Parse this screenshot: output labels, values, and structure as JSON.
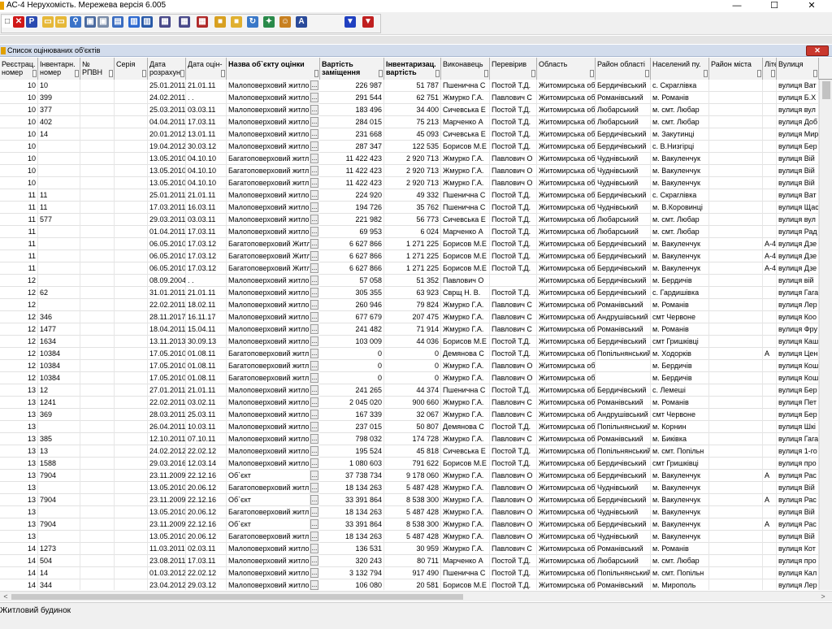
{
  "window": {
    "title": "АС-4 Нерухомість. Мережева версія 6.005",
    "minimize": "—",
    "maximize": "☐",
    "close": "✕"
  },
  "toolbar": {
    "buttons": [
      {
        "name": "new-icon",
        "glyph": "□",
        "color": "#ffffff"
      },
      {
        "name": "delete-icon",
        "glyph": "✕",
        "color": "#d01818"
      },
      {
        "name": "pdf-icon",
        "glyph": "P",
        "color": "#2a4ab0"
      },
      {
        "name": "open-folder-icon",
        "glyph": "▭",
        "color": "#e6b838"
      },
      {
        "name": "folder-icon",
        "glyph": "▭",
        "color": "#e6b838"
      },
      {
        "name": "search-icon",
        "glyph": "⚲",
        "color": "#3b73c8"
      },
      {
        "name": "copy-icon",
        "glyph": "▣",
        "color": "#4a6aa0"
      },
      {
        "name": "paste-icon",
        "glyph": "▣",
        "color": "#7a8ca8"
      },
      {
        "name": "clipboard-icon",
        "glyph": "▤",
        "color": "#3a6cc0"
      },
      {
        "name": "book-icon",
        "glyph": "▥",
        "color": "#2f6ad0"
      },
      {
        "name": "books-icon",
        "glyph": "▥",
        "color": "#2a5aa8"
      },
      {
        "name": "report-icon",
        "glyph": "▦",
        "color": "#4a4a8a"
      },
      {
        "name": "report-export-icon",
        "glyph": "▦",
        "color": "#4a4a8a"
      },
      {
        "name": "report-delete-icon",
        "glyph": "▦",
        "color": "#b02a2a"
      },
      {
        "name": "box-icon",
        "glyph": "■",
        "color": "#d8a020"
      },
      {
        "name": "package-icon",
        "glyph": "■",
        "color": "#e0b030"
      },
      {
        "name": "refresh-icon",
        "glyph": "↻",
        "color": "#3a78c8"
      },
      {
        "name": "map-icon",
        "glyph": "✦",
        "color": "#2a8a4a"
      },
      {
        "name": "users-icon",
        "glyph": "☺",
        "color": "#c88020"
      },
      {
        "name": "sort-icon",
        "glyph": "A",
        "color": "#2a4a9a"
      },
      {
        "name": "filter-icon",
        "glyph": "▼",
        "color": "#2040c0"
      },
      {
        "name": "filter-clear-icon",
        "glyph": "▼",
        "color": "#c02020"
      }
    ]
  },
  "panel": {
    "title": "Список оцінюваних об'єктів",
    "close": "✕"
  },
  "columns": [
    {
      "key": "c0",
      "label": "Реєстрац. номер",
      "bold": false
    },
    {
      "key": "c1",
      "label": "Інвентарн. номер",
      "bold": false
    },
    {
      "key": "c2",
      "label": "№ РПВН",
      "bold": false
    },
    {
      "key": "c3",
      "label": "Серія",
      "bold": false
    },
    {
      "key": "c4",
      "label": "Дата розрахун.",
      "bold": false
    },
    {
      "key": "c5",
      "label": "Дата оцін-",
      "bold": false
    },
    {
      "key": "c6",
      "label": "Назва об`єкту оцінки",
      "bold": true
    },
    {
      "key": "c7",
      "label": "Вартість заміщення",
      "bold": true
    },
    {
      "key": "c8",
      "label": "Інвентаризац. вартість",
      "bold": true
    },
    {
      "key": "c9",
      "label": "Виконавець",
      "bold": false
    },
    {
      "key": "c10",
      "label": "Перевірив",
      "bold": false
    },
    {
      "key": "c11",
      "label": "Область",
      "bold": false
    },
    {
      "key": "c12",
      "label": "Район області",
      "bold": false
    },
    {
      "key": "c13",
      "label": "Населений пу.",
      "bold": false
    },
    {
      "key": "c14",
      "label": "Район міста",
      "bold": false
    },
    {
      "key": "c15",
      "label": "Літе.",
      "bold": false
    },
    {
      "key": "c16",
      "label": "Вулиця",
      "bold": false
    }
  ],
  "rows": [
    [
      "10",
      "10",
      "",
      "",
      "25.01.2011",
      "21.01.11",
      "Малоповерховий житло",
      "226 987",
      "51 787",
      "Пшенична С",
      "Постой Т.Д.",
      "Житомирська об",
      "Бердичівський",
      "с. Скраглівка",
      "",
      "",
      "вулиця Ват"
    ],
    [
      "10",
      "399",
      "",
      "",
      "24.02.2011",
      ". .",
      "Малоповерховий житло",
      "291 544",
      "62 751",
      "Жмурко Г.А.",
      "Павлович С",
      "Житомирська об",
      "Романівський",
      "м. Романів",
      "",
      "",
      "вулиця Б.Х"
    ],
    [
      "10",
      "377",
      "",
      "",
      "25.03.2011",
      "03.03.11",
      "Малоповерховий житло",
      "183 496",
      "34 400",
      "Сичевська Е",
      "Постой Т.Д.",
      "Житомирська об",
      "Любарський",
      "м. смт. Любар",
      "",
      "",
      "вулиця вул"
    ],
    [
      "10",
      "402",
      "",
      "",
      "04.04.2011",
      "17.03.11",
      "Малоповерховий житло",
      "284 015",
      "75 213",
      "Марченко А",
      "Постой Т.Д.",
      "Житомирська об",
      "Любарський",
      "м. смт. Любар",
      "",
      "",
      "вулиця Доб"
    ],
    [
      "10",
      "14",
      "",
      "",
      "20.01.2012",
      "13.01.11",
      "Малоповерховий житло",
      "231 668",
      "45 093",
      "Сичевська Е",
      "Постой Т.Д.",
      "Житомирська об",
      "Бердичівський",
      "м. Закутинці",
      "",
      "",
      "вулиця Мир"
    ],
    [
      "10",
      "",
      "",
      "",
      "19.04.2012",
      "30.03.12",
      "Малоповерховий житло",
      "287 347",
      "122 535",
      "Борисов М.Е",
      "Постой Т.Д.",
      "Житомирська об",
      "Бердичівський",
      "с. В.Низгірці",
      "",
      "",
      "вулиця Бер"
    ],
    [
      "10",
      "",
      "",
      "",
      "13.05.2010",
      "04.10.10",
      "Багатоповерховий житл",
      "11 422 423",
      "2 920 713",
      "Жмурко Г.А.",
      "Павлович О",
      "Житомирська об",
      "Чуднівський",
      "м. Вакуленчук",
      "",
      "",
      "вулиця Вій"
    ],
    [
      "10",
      "",
      "",
      "",
      "13.05.2010",
      "04.10.10",
      "Багатоповерховий житл",
      "11 422 423",
      "2 920 713",
      "Жмурко Г.А.",
      "Павлович О",
      "Житомирська об",
      "Чуднівський",
      "м. Вакуленчук",
      "",
      "",
      "вулиця Вій"
    ],
    [
      "10",
      "",
      "",
      "",
      "13.05.2010",
      "04.10.10",
      "Багатоповерховий житл",
      "11 422 423",
      "2 920 713",
      "Жмурко Г.А.",
      "Павлович О",
      "Житомирська об",
      "Чуднівський",
      "м. Вакуленчук",
      "",
      "",
      "вулиця Вій"
    ],
    [
      "11",
      "11",
      "",
      "",
      "25.01.2011",
      "21.01.11",
      "Малоповерховий житло",
      "224 920",
      "49 332",
      "Пшенична С",
      "Постой Т.Д.",
      "Житомирська об",
      "Бердичівський",
      "с. Скраглівка",
      "",
      "",
      "вулиця Ват"
    ],
    [
      "11",
      "11",
      "",
      "",
      "17.03.2011",
      "16.03.11",
      "Малоповерховий житло",
      "194 726",
      "35 762",
      "Пшенична С",
      "Постой Т.Д.",
      "Житомирська об",
      "Чуднівський",
      "м. В.Коровинці",
      "",
      "",
      "вулиця Щас"
    ],
    [
      "11",
      "577",
      "",
      "",
      "29.03.2011",
      "03.03.11",
      "Малоповерховий житло",
      "221 982",
      "56 773",
      "Сичевська Е",
      "Постой Т.Д.",
      "Житомирська об",
      "Любарський",
      "м. смт. Любар",
      "",
      "",
      "вулиця вул"
    ],
    [
      "11",
      "",
      "",
      "",
      "01.04.2011",
      "17.03.11",
      "Малоповерховий житло",
      "69 953",
      "6 024",
      "Марченко А",
      "Постой Т.Д.",
      "Житомирська об",
      "Любарський",
      "м. смт. Любар",
      "",
      "",
      "вулиця Рад"
    ],
    [
      "11",
      "",
      "",
      "",
      "06.05.2010",
      "17.03.12",
      "Багатоповерховий Житл",
      "6 627 866",
      "1 271 225",
      "Борисов М.Е",
      "Постой Т.Д.",
      "Житомирська об",
      "Бердичівський",
      "м. Вакуленчук",
      "",
      "А-4",
      "вулиця Дзе"
    ],
    [
      "11",
      "",
      "",
      "",
      "06.05.2010",
      "17.03.12",
      "Багатоповерховий Житл",
      "6 627 866",
      "1 271 225",
      "Борисов М.Е",
      "Постой Т.Д.",
      "Житомирська об",
      "Бердичівський",
      "м. Вакуленчук",
      "",
      "А-4",
      "вулиця Дзе"
    ],
    [
      "11",
      "",
      "",
      "",
      "06.05.2010",
      "17.03.12",
      "Багатоповерховий Житл",
      "6 627 866",
      "1 271 225",
      "Борисов М.Е",
      "Постой Т.Д.",
      "Житомирська об",
      "Бердичівський",
      "м. Вакуленчук",
      "",
      "А-4",
      "вулиця Дзе"
    ],
    [
      "12",
      "",
      "",
      "",
      "08.09.2004",
      ". .",
      "Малоповерховий житло",
      "57 058",
      "51 352",
      "Павлович О",
      "",
      "Житомирська об",
      "Бердичівський",
      "м. Бердичів",
      "",
      "",
      "вулиця вій"
    ],
    [
      "12",
      "62",
      "",
      "",
      "31.01.2011",
      "21.01.11",
      "Малоповерховий житло",
      "305 355",
      "63 923",
      "Сврщ Н. В.",
      "Постой Т.Д.",
      "Житомирська об",
      "Бердичівський",
      "с. Гардишівка",
      "",
      "",
      "вулиця Гага"
    ],
    [
      "12",
      "",
      "",
      "",
      "22.02.2011",
      "18.02.11",
      "Малоповерховий житло",
      "260 946",
      "79 824",
      "Жмурко Г.А.",
      "Павлович С",
      "Житомирська об",
      "Романівський",
      "м. Романів",
      "",
      "",
      "вулиця Лер"
    ],
    [
      "12",
      "346",
      "",
      "",
      "28.11.2017",
      "16.11.17",
      "Малоповерховий житло",
      "677 679",
      "207 475",
      "Жмурко Г.А.",
      "Павлович С",
      "Житомирська об",
      "Андрушівський",
      "смт Червоне",
      "",
      "",
      "вулиця Коо"
    ],
    [
      "12",
      "1477",
      "",
      "",
      "18.04.2011",
      "15.04.11",
      "Малоповерховий житло",
      "241 482",
      "71 914",
      "Жмурко Г.А.",
      "Павлович С",
      "Житомирська об",
      "Романівський",
      "м. Романів",
      "",
      "",
      "вулиця Фру"
    ],
    [
      "12",
      "1634",
      "",
      "",
      "13.11.2013",
      "30.09.13",
      "Малоповерховий житло",
      "103 009",
      "44 036",
      "Борисов М.Е",
      "Постой Т.Д.",
      "Житомирська об",
      "Бердичівський",
      "смт Гришківці",
      "",
      "",
      "вулиця Каш"
    ],
    [
      "12",
      "10384",
      "",
      "",
      "17.05.2010",
      "01.08.11",
      "Багатоповерховий житл",
      "0",
      "0",
      "Демянова С",
      "Постой Т.Д.",
      "Житомирська об",
      "Попільнянський",
      "м. Ходорків",
      "",
      "А",
      "вулиця Цен"
    ],
    [
      "12",
      "10384",
      "",
      "",
      "17.05.2010",
      "01.08.11",
      "Багатоповерховий житл",
      "0",
      "0",
      "Жмурко Г.А.",
      "Павлович О",
      "Житомирська об",
      "",
      "м. Бердичів",
      "",
      "",
      "вулиця Кош"
    ],
    [
      "12",
      "10384",
      "",
      "",
      "17.05.2010",
      "01.08.11",
      "Багатоповерховий житл",
      "0",
      "0",
      "Жмурко Г.А.",
      "Павлович О",
      "Житомирська об",
      "",
      "м. Бердичів",
      "",
      "",
      "вулиця Кош"
    ],
    [
      "13",
      "12",
      "",
      "",
      "27.01.2011",
      "21.01.11",
      "Малоповерховий житло",
      "241 265",
      "44 374",
      "Пшенична С",
      "Постой Т.Д.",
      "Житомирська об",
      "Бердичівський",
      "с. Лемеші",
      "",
      "",
      "вулиця Бер"
    ],
    [
      "13",
      "1241",
      "",
      "",
      "22.02.2011",
      "03.02.11",
      "Малоповерховий житло",
      "2 045 020",
      "900 660",
      "Жмурко Г.А.",
      "Павлович С",
      "Житомирська об",
      "Романівський",
      "м. Романів",
      "",
      "",
      "вулиця Пет"
    ],
    [
      "13",
      "369",
      "",
      "",
      "28.03.2011",
      "25.03.11",
      "Малоповерховий житло",
      "167 339",
      "32 067",
      "Жмурко Г.А.",
      "Павлович С",
      "Житомирська об",
      "Андрушівський",
      "смт Червоне",
      "",
      "",
      "вулиця Бер"
    ],
    [
      "13",
      "",
      "",
      "",
      "26.04.2011",
      "10.03.11",
      "Малоповерховий житло",
      "237 015",
      "50 807",
      "Демянова С",
      "Постой Т.Д.",
      "Житомирська об",
      "Попільнянський",
      "м. Корнин",
      "",
      "",
      "вулиця Шкі"
    ],
    [
      "13",
      "385",
      "",
      "",
      "12.10.2011",
      "07.10.11",
      "Малоповерховий житло",
      "798 032",
      "174 728",
      "Жмурко Г.А.",
      "Павлович С",
      "Житомирська об",
      "Романівський",
      "м. Биківка",
      "",
      "",
      "вулиця Гага"
    ],
    [
      "13",
      "13",
      "",
      "",
      "24.02.2012",
      "22.02.12",
      "Малоповерховий житло",
      "195 524",
      "45 818",
      "Сичевська Е",
      "Постой Т.Д.",
      "Житомирська об",
      "Попільнянський",
      "м. смт. Попільн",
      "",
      "",
      "вулиця 1-го"
    ],
    [
      "13",
      "1588",
      "",
      "",
      "29.03.2016",
      "12.03.14",
      "Малоповерховий житло",
      "1 080 603",
      "791 622",
      "Борисов М.Е",
      "Постой Т.Д.",
      "Житомирська об",
      "Бердичівський",
      "смт Гришківці",
      "",
      "",
      "вулиця про"
    ],
    [
      "13",
      "7904",
      "",
      "",
      "23.11.2009",
      "22.12.16",
      "Об`єкт",
      "37 738 734",
      "9 178 060",
      "Жмурко Г.А.",
      "Павлович О",
      "Житомирська об",
      "Бердичівський",
      "м. Вакуленчук",
      "",
      "А",
      "вулиця Рас"
    ],
    [
      "13",
      "",
      "",
      "",
      "13.05.2010",
      "20.06.12",
      "Багатоповерховий житл",
      "18 134 263",
      "5 487 428",
      "Жмурко Г.А.",
      "Павлович О",
      "Житомирська об",
      "Чуднівський",
      "м. Вакуленчук",
      "",
      "",
      "вулиця Вій"
    ],
    [
      "13",
      "7904",
      "",
      "",
      "23.11.2009",
      "22.12.16",
      "Об`єкт",
      "33 391 864",
      "8 538 300",
      "Жмурко Г.А.",
      "Павлович О",
      "Житомирська об",
      "Бердичівський",
      "м. Вакуленчук",
      "",
      "А",
      "вулиця Рас"
    ],
    [
      "13",
      "",
      "",
      "",
      "13.05.2010",
      "20.06.12",
      "Багатоповерховий житл",
      "18 134 263",
      "5 487 428",
      "Жмурко Г.А.",
      "Павлович О",
      "Житомирська об",
      "Чуднівський",
      "м. Вакуленчук",
      "",
      "",
      "вулиця Вій"
    ],
    [
      "13",
      "7904",
      "",
      "",
      "23.11.2009",
      "22.12.16",
      "Об`єкт",
      "33 391 864",
      "8 538 300",
      "Жмурко Г.А.",
      "Павлович О",
      "Житомирська об",
      "Бердичівський",
      "м. Вакуленчук",
      "",
      "А",
      "вулиця Рас"
    ],
    [
      "13",
      "",
      "",
      "",
      "13.05.2010",
      "20.06.12",
      "Багатоповерховий житл",
      "18 134 263",
      "5 487 428",
      "Жмурко Г.А.",
      "Павлович О",
      "Житомирська об",
      "Чуднівський",
      "м. Вакуленчук",
      "",
      "",
      "вулиця Вій"
    ],
    [
      "14",
      "1273",
      "",
      "",
      "11.03.2011",
      "02.03.11",
      "Малоповерховий житло",
      "136 531",
      "30 959",
      "Жмурко Г.А.",
      "Павлович С",
      "Житомирська об",
      "Романівський",
      "м. Романів",
      "",
      "",
      "вулиця Кот"
    ],
    [
      "14",
      "504",
      "",
      "",
      "23.08.2011",
      "17.03.11",
      "Малоповерховий житло",
      "320 243",
      "80 711",
      "Марченко А",
      "Постой Т.Д.",
      "Житомирська об",
      "Любарський",
      "м. смт. Любар",
      "",
      "",
      "вулиця про"
    ],
    [
      "14",
      "14",
      "",
      "",
      "01.03.2012",
      "22.02.12",
      "Малоповерховий житло",
      "3 132 794",
      "917 490",
      "Пшенична С",
      "Постой Т.Д.",
      "Житомирська об",
      "Попільнянський",
      "м. смт. Попільн",
      "",
      "",
      "вулиця Кал"
    ],
    [
      "14",
      "344",
      "",
      "",
      "23.04.2012",
      "29.03.12",
      "Малоповерховий житло",
      "106 080",
      "20 581",
      "Борисов М.Е",
      "Постой Т.Д.",
      "Житомирська об",
      "Романівський",
      "м. Мирополь",
      "",
      "",
      "вулиця Лер"
    ]
  ],
  "scroll": {
    "left": "<",
    "right": ">"
  },
  "status": {
    "text": "Житловий будинок"
  }
}
